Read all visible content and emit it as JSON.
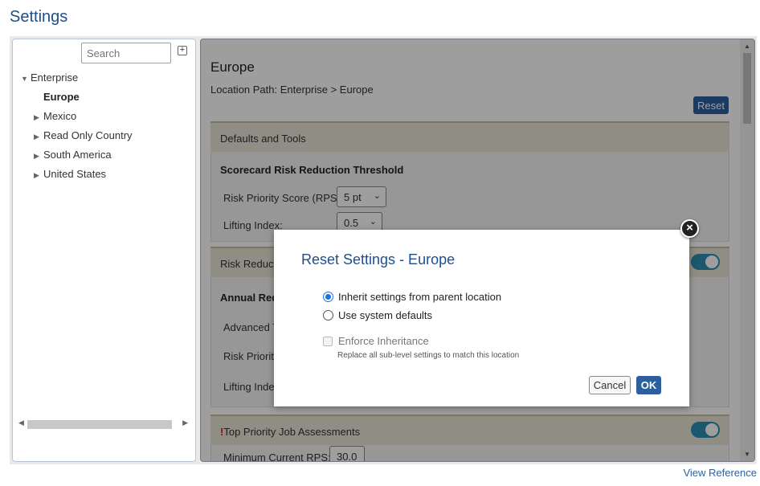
{
  "page": {
    "title": "Settings",
    "view_reference_link": "View Reference"
  },
  "tree": {
    "search_placeholder": "Search",
    "expand_all_icon": "plus-square-icon",
    "items": [
      {
        "label": "Enterprise",
        "expanded": true,
        "level": 0
      },
      {
        "label": "Europe",
        "selected": true,
        "level": 1
      },
      {
        "label": "Mexico",
        "level": 1
      },
      {
        "label": "Read Only Country",
        "level": 1
      },
      {
        "label": "South America",
        "level": 1
      },
      {
        "label": "United States",
        "level": 1
      }
    ]
  },
  "content": {
    "location_title": "Europe",
    "location_path": "Location Path: Enterprise > Europe",
    "reset_label": "Reset",
    "sections": {
      "defaults_and_tools": {
        "header": "Defaults and Tools",
        "subheading": "Scorecard Risk Reduction Threshold",
        "rps_label": "Risk Priority Score (RPS):",
        "rps_value": "5 pt",
        "lifting_label": "Lifting Index:",
        "lifting_value": "0.5"
      },
      "risk_reduction": {
        "header_partial": "Risk Reduct",
        "annual_partial": "Annual Red",
        "advanced_partial": "Advanced T",
        "risk_priority_partial": "Risk Priority",
        "lifting_partial": "Lifting Inde"
      },
      "top_priority": {
        "exclamation": "!",
        "header": "Top Priority Job Assessments",
        "min_rps_label": "Minimum Current RPS:",
        "min_rps_value": "30.0"
      }
    }
  },
  "modal": {
    "title": "Reset Settings - Europe",
    "option_inherit": "Inherit settings from parent location",
    "option_defaults": "Use system defaults",
    "selected_option": "inherit",
    "enforce_label": "Enforce Inheritance",
    "enforce_help": "Replace all sub-level settings to match this location",
    "cancel_label": "Cancel",
    "ok_label": "OK",
    "close_icon": "close-circle-icon"
  },
  "colors": {
    "brand": "#1f4e8c",
    "button": "#2c5f9e",
    "toggle": "#2c8fb0",
    "section_header": "#e9e4d6"
  }
}
